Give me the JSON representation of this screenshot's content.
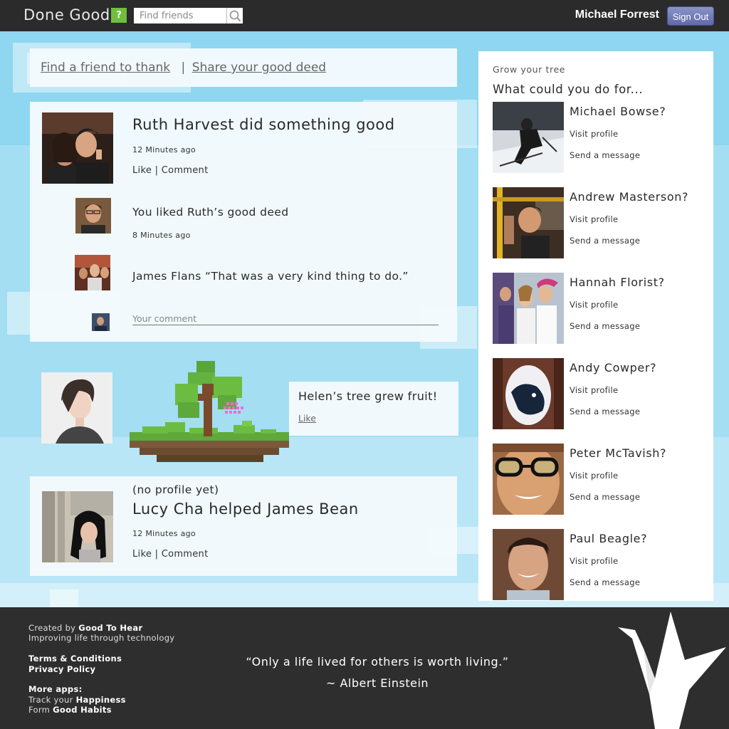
{
  "header": {
    "logo": "Done Good",
    "help_label": "?",
    "search_placeholder": "Find friends",
    "user_name": "Michael Forrest",
    "sign_out_label": "Sign Out"
  },
  "actions": {
    "find_friend": "Find a friend to thank",
    "separator": "|",
    "share_deed": "Share your good deed"
  },
  "feed": {
    "post1": {
      "title": "Ruth Harvest did something good",
      "time": "12 Minutes ago",
      "like": "Like",
      "sep": "|",
      "comment": "Comment",
      "reply1_text": "You liked Ruth’s good deed",
      "reply1_time": "8 Minutes ago",
      "reply2_text": "James Flans “That was a very kind thing to do.”",
      "comment_placeholder": "Your comment"
    },
    "tree": {
      "text": "Helen’s tree grew fruit!",
      "like": "Like"
    },
    "post3": {
      "note": "(no profile yet)",
      "title": "Lucy Cha helped James Bean",
      "time": "12 Minutes ago",
      "like": "Like",
      "sep": "|",
      "comment": "Comment"
    }
  },
  "sidebar": {
    "small_title": "Grow your tree",
    "title": "What could you do for...",
    "visit_label": "Visit profile",
    "message_label": "Send a message",
    "people": [
      {
        "name": "Michael Bowse?"
      },
      {
        "name": "Andrew Masterson?"
      },
      {
        "name": "Hannah Florist?"
      },
      {
        "name": "Andy Cowper?"
      },
      {
        "name": "Peter McTavish?"
      },
      {
        "name": "Paul Beagle?"
      }
    ]
  },
  "footer": {
    "created_prefix": "Created by",
    "created_by": "Good To Hear",
    "tagline": "Improving life through technology",
    "terms": "Terms & Conditions",
    "privacy": "Privacy Policy",
    "more_apps": "More apps:",
    "app1_prefix": "Track your",
    "app1": "Happiness",
    "app2_prefix": "Form",
    "app2": "Good Habits",
    "quote": "“Only a life lived for others is worth living.”",
    "author": "~ Albert Einstein"
  },
  "colors": {
    "topbar": "#2b2b2b",
    "sky": "#9fdcf2",
    "help_green": "#6fbf3c",
    "sign_out": "#6f78b8",
    "footer": "#2e2e2e"
  }
}
